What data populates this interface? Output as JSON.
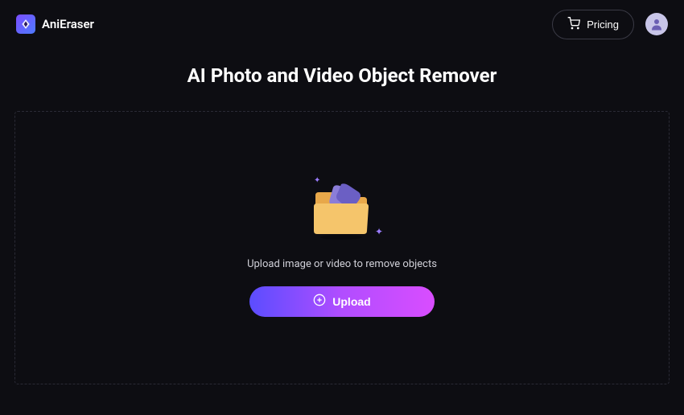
{
  "header": {
    "app_name": "AniEraser",
    "pricing_label": "Pricing"
  },
  "main": {
    "title": "AI Photo and Video Object Remover",
    "upload_instruction": "Upload image or video to remove objects",
    "upload_button_label": "Upload"
  },
  "colors": {
    "background": "#0d0d12",
    "accent_gradient_start": "#5b4dff",
    "accent_gradient_end": "#d94dff",
    "text_primary": "#ffffff",
    "text_secondary": "#d0d0d8",
    "border_dashed": "#2a2a35"
  }
}
